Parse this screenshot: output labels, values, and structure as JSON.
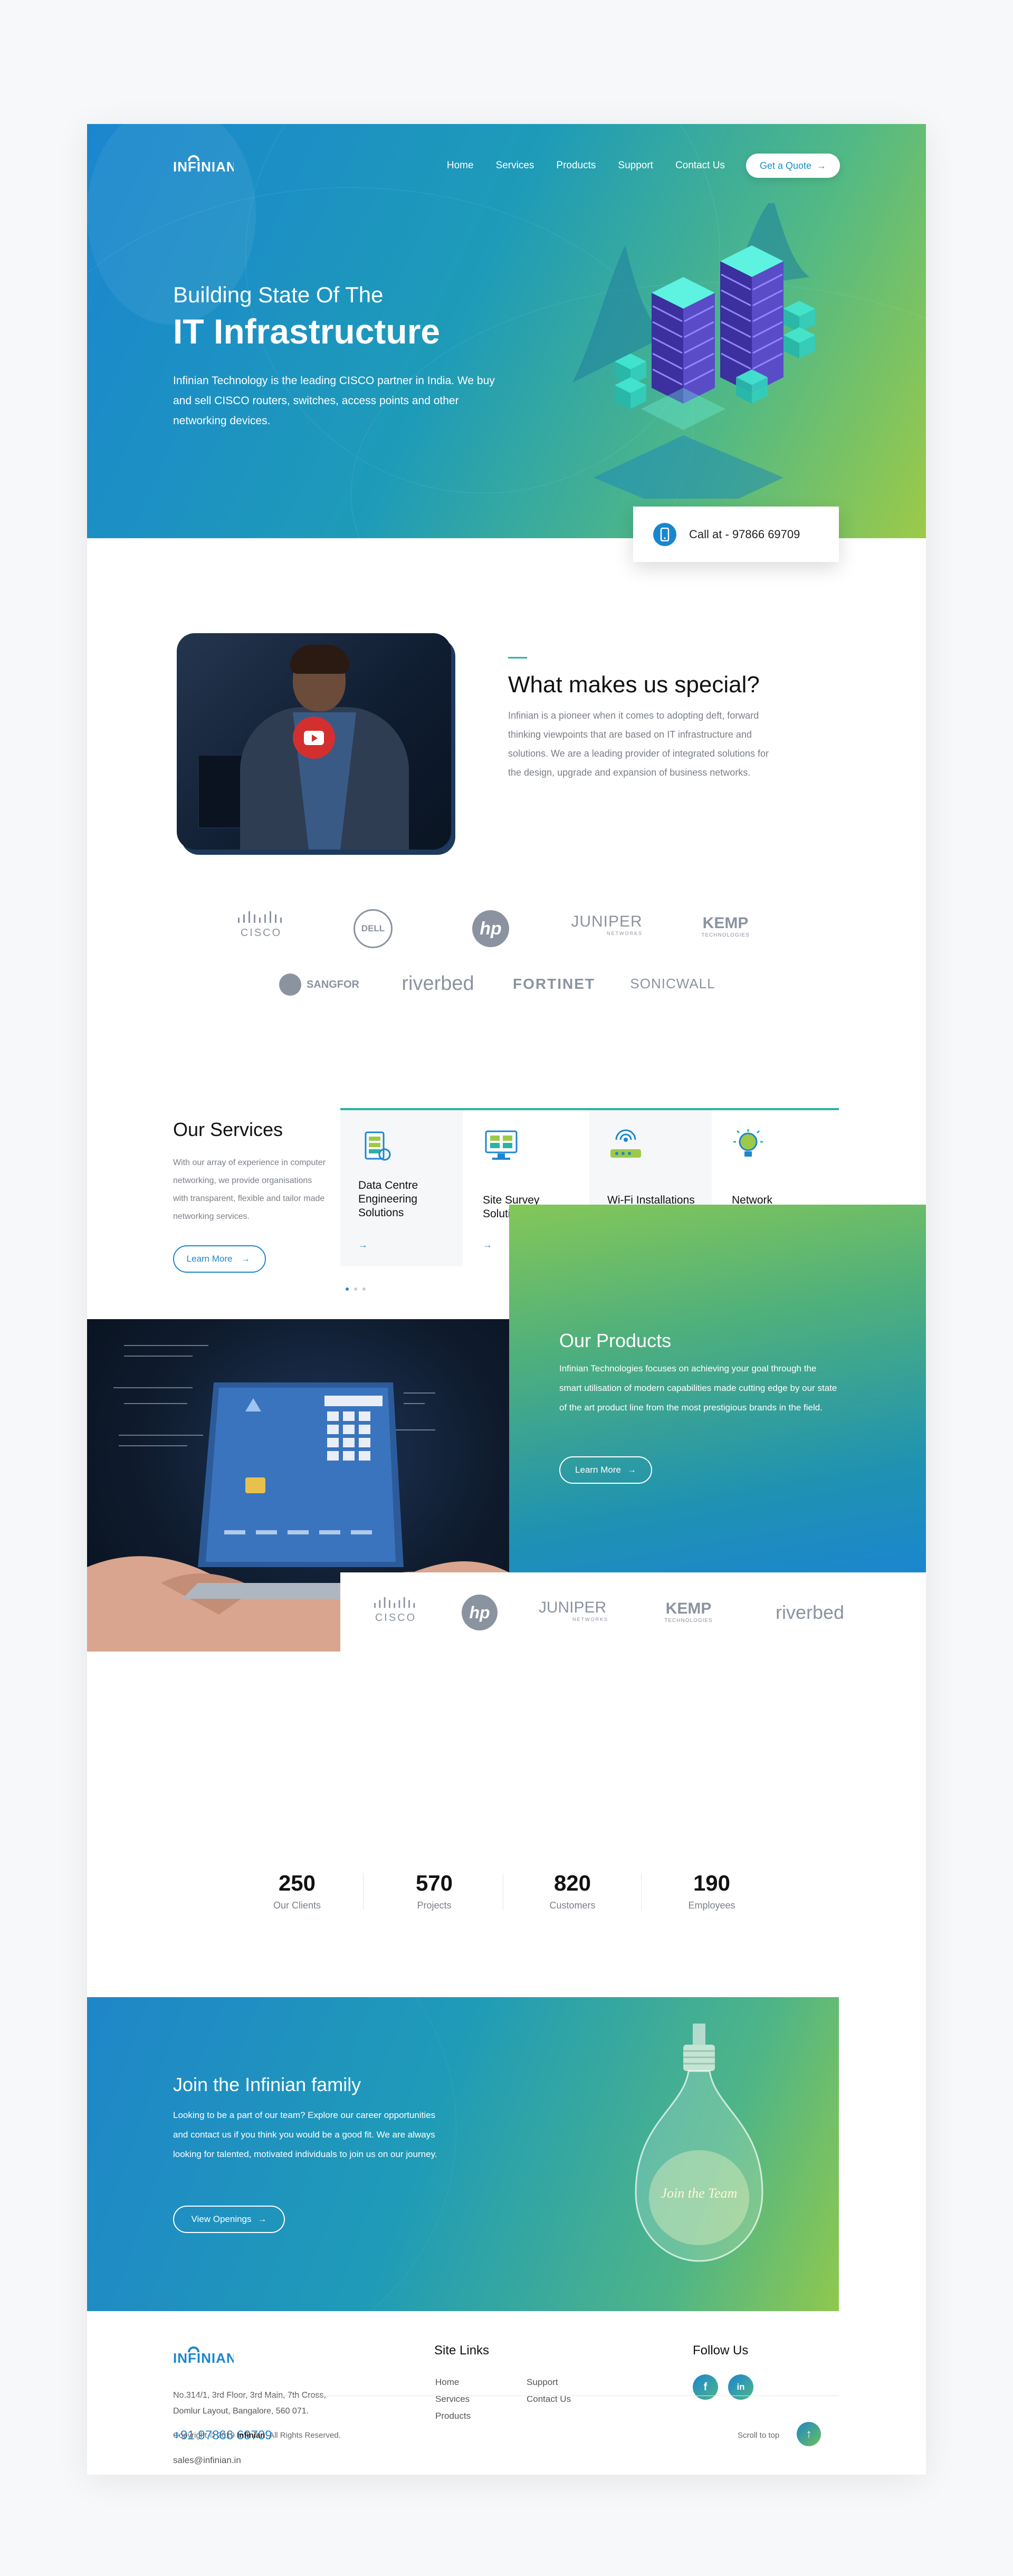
{
  "brand": {
    "logo_text": "INFINIAN",
    "primary": "#1b86cf",
    "accent_teal": "#2ab3a6",
    "accent_green": "#9cca48"
  },
  "nav": {
    "items": [
      "Home",
      "Services",
      "Products",
      "Support",
      "Contact Us"
    ],
    "cta_label": "Get a Quote",
    "cta_icon": "arrow-right-icon"
  },
  "hero": {
    "subtitle": "Building State Of The",
    "title": "IT Infrastructure",
    "description": "Infinian Technology is the leading CISCO partner in India. We buy and sell CISCO routers, switches, access points and other networking devices.",
    "illustration": "isometric-server-stacks"
  },
  "call": {
    "label": "Call at - 97866 69709",
    "icon": "phone-icon"
  },
  "special": {
    "title": "What makes us special?",
    "text": "Infinian is a pioneer when it comes to adopting deft, forward thinking viewpoints that are based on IT infrastructure and solutions. We are a leading provider of integrated solutions for the design, upgrade and expansion of business networks.",
    "video_icon": "youtube-play-icon"
  },
  "partners": {
    "row1": [
      "CISCO",
      "DELL",
      "hp",
      "JUNIPER",
      "KEMP"
    ],
    "row1_sub": [
      "",
      "",
      "",
      "NETWORKS",
      "TECHNOLOGIES"
    ],
    "row2": [
      "SANGFOR",
      "riverbed",
      "FORTINET",
      "SONICWALL"
    ]
  },
  "services": {
    "title": "Our Services",
    "text": "With our array of experience in computer networking, we provide organisations with transparent, flexible and tailor made networking services.",
    "button": "Learn More",
    "cards": [
      {
        "title": "Data Centre Engineering Solutions",
        "icon": "data-centre-icon"
      },
      {
        "title": "Site Survey Solutions",
        "icon": "site-survey-icon"
      },
      {
        "title": "Wi-Fi Installations",
        "icon": "wifi-router-icon"
      },
      {
        "title": "Network Solutions",
        "icon": "lightbulb-network-icon"
      }
    ]
  },
  "products": {
    "title": "Our Products",
    "text": "Infinian Technologies focuses on achieving your goal through the smart utilisation of modern capabilities made cutting edge by our state of the art product line from the most prestigious brands in the field.",
    "button": "Learn More",
    "brands": [
      "CISCO",
      "hp",
      "JUNIPER",
      "KEMP",
      "riverbed"
    ],
    "brands_sub": [
      "",
      "",
      "NETWORKS",
      "TECHNOLOGIES",
      ""
    ]
  },
  "stats": [
    {
      "num": "250",
      "label": "Our Clients"
    },
    {
      "num": "570",
      "label": "Projects"
    },
    {
      "num": "820",
      "label": "Customers"
    },
    {
      "num": "190",
      "label": "Employees"
    }
  ],
  "join": {
    "title": "Join the Infinian family",
    "text": "Looking to be a part of our team? Explore our career opportunities and contact us if you think you would be a good fit. We are always looking for talented, motivated individuals to join us on our journey.",
    "button": "View Openings",
    "bulb_text": "Join the Team"
  },
  "footer": {
    "address": "No.314/1, 3rd Floor, 3rd Main, 7th Cross, Domlur Layout, Bangalore, 560 071.",
    "phone": "+91 97866 69709",
    "email": "sales@infinian.in",
    "site_links_title": "Site Links",
    "links_col1": [
      "Home",
      "Services",
      "Products"
    ],
    "links_col2": [
      "Support",
      "Contact Us"
    ],
    "follow_title": "Follow Us",
    "social": [
      "f",
      "in"
    ],
    "copyright_pre": "Copyright © 2019",
    "copyright_brand": "Infinian",
    "copyright_post": ". All Rights Reserved.",
    "scroll_top": "Scroll to top"
  }
}
